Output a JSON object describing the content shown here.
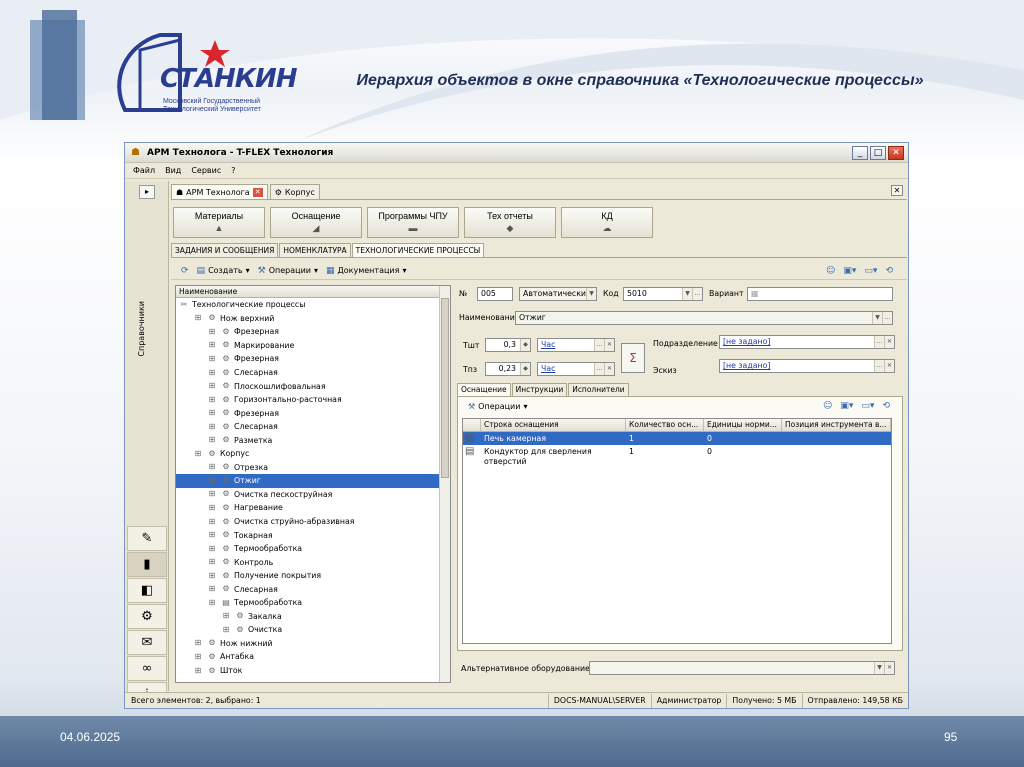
{
  "slide": {
    "title": "Иерархия объектов в окне справочника «Технологические процессы»",
    "logo_name": "СТАНКИН",
    "logo_sub1": "Московский Государственный",
    "logo_sub2": "Технологический Университет",
    "date": "04.06.2025",
    "page_number": "95"
  },
  "window": {
    "title": "АРМ Технолога - T-FLEX Технология",
    "menu": [
      "Файл",
      "Вид",
      "Сервис",
      "?"
    ],
    "left_panel_label": "Справочники",
    "doc_tabs": [
      {
        "label": "АРМ Технолога",
        "active": true
      },
      {
        "label": "Корпус",
        "active": false
      }
    ],
    "big_buttons": [
      "Материалы",
      "Оснащение",
      "Программы ЧПУ",
      "Тех отчеты",
      "КД"
    ],
    "sub_tabs": [
      "ЗАДАНИЯ И СООБЩЕНИЯ",
      "НОМЕНКЛАТУРА",
      "ТЕХНОЛОГИЧЕСКИЕ ПРОЦЕССЫ"
    ],
    "toolbar": {
      "create": "Создать",
      "operations": "Операции",
      "documentation": "Документация"
    },
    "tree": {
      "header": "Наименование",
      "rows": [
        {
          "label": "Технологические процессы",
          "level": 0,
          "icon": "process-root-icon"
        },
        {
          "label": "Нож верхний",
          "level": 1,
          "icon": "gear-icon"
        },
        {
          "label": "Фрезерная",
          "level": 2,
          "icon": "operation-icon"
        },
        {
          "label": "Маркирование",
          "level": 2,
          "icon": "operation-icon"
        },
        {
          "label": "Фрезерная",
          "level": 2,
          "icon": "operation-icon"
        },
        {
          "label": "Слесарная",
          "level": 2,
          "icon": "operation-icon"
        },
        {
          "label": "Плоскошлифовальная",
          "level": 2,
          "icon": "operation-icon"
        },
        {
          "label": "Горизонтально-расточная",
          "level": 2,
          "icon": "operation-icon"
        },
        {
          "label": "Фрезерная",
          "level": 2,
          "icon": "operation-icon"
        },
        {
          "label": "Слесарная",
          "level": 2,
          "icon": "operation-icon"
        },
        {
          "label": "Разметка",
          "level": 2,
          "icon": "operation-icon"
        },
        {
          "label": "Корпус",
          "level": 1,
          "icon": "gear-icon"
        },
        {
          "label": "Отрезка",
          "level": 2,
          "icon": "operation-icon"
        },
        {
          "label": "Отжиг",
          "level": 2,
          "icon": "operation-icon",
          "selected": true
        },
        {
          "label": "Очистка пескоструйная",
          "level": 2,
          "icon": "operation-icon"
        },
        {
          "label": "Нагревание",
          "level": 2,
          "icon": "operation-icon"
        },
        {
          "label": "Очистка струйно-абразивная",
          "level": 2,
          "icon": "operation-icon"
        },
        {
          "label": "Токарная",
          "level": 2,
          "icon": "operation-icon"
        },
        {
          "label": "Термообработка",
          "level": 2,
          "icon": "operation-icon"
        },
        {
          "label": "Контроль",
          "level": 2,
          "icon": "operation-icon"
        },
        {
          "label": "Получение покрытия",
          "level": 2,
          "icon": "operation-icon"
        },
        {
          "label": "Слесарная",
          "level": 2,
          "icon": "operation-icon"
        },
        {
          "label": "Термообработка",
          "level": 2,
          "icon": "folder-icon"
        },
        {
          "label": "Закалка",
          "level": 3,
          "icon": "operation-icon"
        },
        {
          "label": "Очистка",
          "level": 3,
          "icon": "operation-icon"
        },
        {
          "label": "Нож нижний",
          "level": 1,
          "icon": "gear-icon"
        },
        {
          "label": "Антабка",
          "level": 1,
          "icon": "gear-icon"
        },
        {
          "label": "Шток",
          "level": 1,
          "icon": "gear-icon"
        }
      ]
    },
    "form": {
      "num_label": "№",
      "num_value": "005",
      "type_value": "Автоматически",
      "code_label": "Код",
      "code_value": "5010",
      "variant_label": "Вариант",
      "name_label": "Наименование",
      "name_value": "Отжиг",
      "tsht_label": "Тшт",
      "tsht_value": "0,3",
      "tsht_unit": "Час",
      "tpz_label": "Тпз",
      "tpz_value": "0,23",
      "tpz_unit": "Час",
      "sigma": "Σ",
      "dept_label": "Подразделение",
      "dept_value": "[не задано]",
      "sketch_label": "Эскиз",
      "sketch_value": "[не задано]"
    },
    "inner_tabs": [
      "Оснащение",
      "Инструкции",
      "Исполнители"
    ],
    "inner_toolbar_operations": "Операции",
    "grid": {
      "columns": [
        "Строка оснащения",
        "Количество осн...",
        "Единицы норми...",
        "Позиция инструмента в..."
      ],
      "rows": [
        {
          "name": "Печь камерная",
          "qty": "1",
          "unit": "0",
          "selected": true
        },
        {
          "name": "Кондуктор для сверления отверстий",
          "qty": "1",
          "unit": "0",
          "selected": false
        }
      ]
    },
    "alt_equipment_label": "Альтернативное оборудование",
    "status": {
      "left": "Всего элементов: 2, выбрано: 1",
      "server": "DOCS-MANUAL\\SERVER",
      "user": "Администратор",
      "received": "Получено: 5 МБ",
      "sent": "Отправлено: 149,58 КБ"
    }
  }
}
